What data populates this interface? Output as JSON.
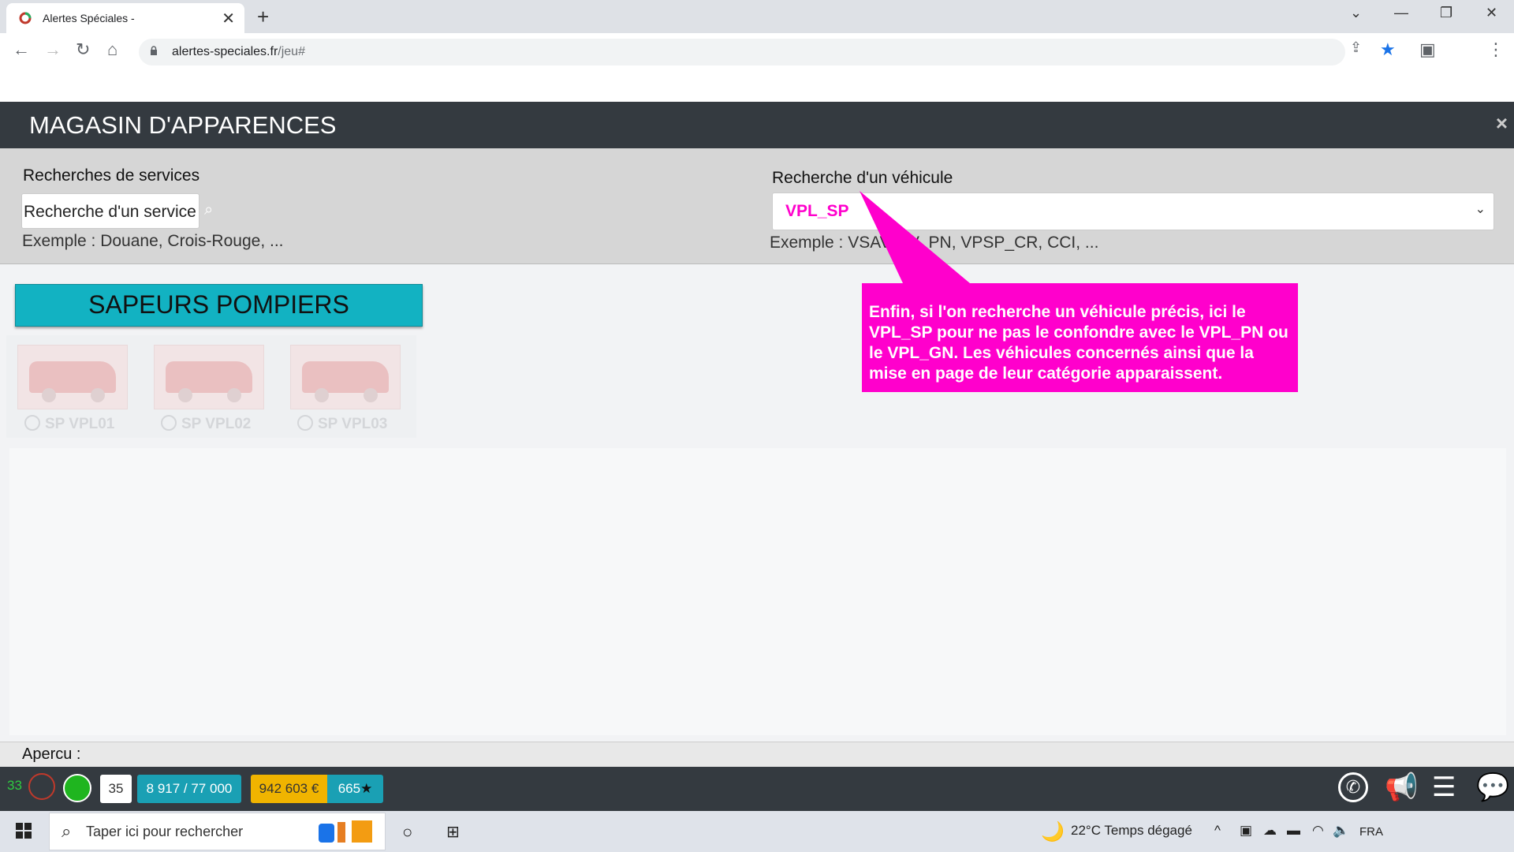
{
  "browser": {
    "tab_title": "Alertes Spéciales -",
    "tab_close": "✕",
    "new_tab": "+",
    "url_host": "alertes-speciales.fr",
    "url_path": "/jeu#",
    "window_controls": [
      "chevron-down-icon",
      "minimize-icon",
      "restore-icon",
      "close-icon"
    ]
  },
  "modal": {
    "title": "MAGASIN D'APPARENCES",
    "close": "×"
  },
  "service_search": {
    "label": "Recherches de services",
    "placeholder": "Recherche d'un service",
    "hint": "Exemple : Douane, Crois-Rouge, ..."
  },
  "vehicle_search": {
    "label": "Recherche d'un véhicule",
    "selected": "VPL_SP",
    "hint": "Exemple : VSAV, TV_PN, VPSP_CR, CCI, ..."
  },
  "category": {
    "title": "SAPEURS POMPIERS",
    "vehicles": [
      {
        "label": "SP VPL01"
      },
      {
        "label": "SP VPL02"
      },
      {
        "label": "SP VPL03"
      }
    ]
  },
  "callout": {
    "text": "Enfin, si l'on recherche un véhicule précis, ici le VPL_SP pour ne pas le confondre avec le VPL_PN ou le VPL_GN. Les véhicules concernés ainsi que la mise en page de leur catégorie apparaissent.",
    "color": "#ff00cc"
  },
  "preview": {
    "label": "Apercu :"
  },
  "status_bar": {
    "count_green": "33",
    "badge_35": "35",
    "capacity": "8 917 / 77 000",
    "money": "942 603 €",
    "stars": "665",
    "right_icons": [
      "phone-icon",
      "megaphone-icon",
      "menu-icon",
      "chat-icon"
    ]
  },
  "taskbar": {
    "search_placeholder": "Taper ici pour rechercher",
    "weather": "22°C  Temps dégagé",
    "lang": "FRA"
  }
}
